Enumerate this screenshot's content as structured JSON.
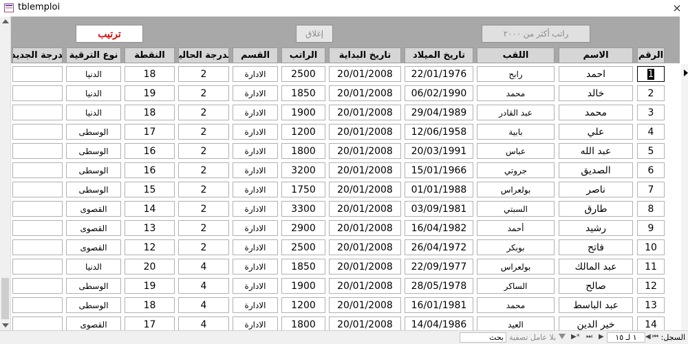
{
  "window": {
    "title": "tblemploi",
    "close_glyph": "×"
  },
  "buttons": {
    "sort": "ترتيب",
    "close": "إغلاق",
    "salary_filter": "راتب أكثر من ٢٠٠٠"
  },
  "columns": [
    {
      "key": "num",
      "label": "الرقم"
    },
    {
      "key": "name",
      "label": "الاسم"
    },
    {
      "key": "surname",
      "label": "اللقب"
    },
    {
      "key": "birth",
      "label": "تاريخ الميلاد"
    },
    {
      "key": "start",
      "label": "تاريخ البداية"
    },
    {
      "key": "salary",
      "label": "الراتب"
    },
    {
      "key": "dept",
      "label": "القسم"
    },
    {
      "key": "cur_grade",
      "label": "الدرجة الحالية"
    },
    {
      "key": "points",
      "label": "النقطة"
    },
    {
      "key": "promo",
      "label": "نوع الترقية"
    },
    {
      "key": "new_grade",
      "label": "الدرجة الجديدة"
    }
  ],
  "rows": [
    {
      "num": "1",
      "name": "احمد",
      "surname": "رابح",
      "birth": "22/01/1976",
      "start": "20/01/2008",
      "salary": "2500",
      "dept": "الادارة",
      "cur_grade": "2",
      "points": "18",
      "promo": "الدنيا",
      "new_grade": ""
    },
    {
      "num": "2",
      "name": "خالد",
      "surname": "محمد",
      "birth": "06/02/1990",
      "start": "20/01/2008",
      "salary": "1850",
      "dept": "الادارة",
      "cur_grade": "2",
      "points": "19",
      "promo": "الدنيا",
      "new_grade": ""
    },
    {
      "num": "3",
      "name": "محمد",
      "surname": "عبد القادر",
      "birth": "29/04/1989",
      "start": "20/01/2008",
      "salary": "1900",
      "dept": "الادارة",
      "cur_grade": "2",
      "points": "18",
      "promo": "الدنيا",
      "new_grade": ""
    },
    {
      "num": "4",
      "name": "علي",
      "surname": "بابية",
      "birth": "12/06/1958",
      "start": "20/01/2008",
      "salary": "1200",
      "dept": "الادارة",
      "cur_grade": "2",
      "points": "17",
      "promo": "الوسطى",
      "new_grade": ""
    },
    {
      "num": "5",
      "name": "عبد الله",
      "surname": "عباس",
      "birth": "20/03/1991",
      "start": "20/01/2008",
      "salary": "1800",
      "dept": "الادارة",
      "cur_grade": "2",
      "points": "16",
      "promo": "الوسطى",
      "new_grade": ""
    },
    {
      "num": "6",
      "name": "الصديق",
      "surname": "جروتي",
      "birth": "15/01/1966",
      "start": "20/01/2008",
      "salary": "3200",
      "dept": "الادارة",
      "cur_grade": "2",
      "points": "16",
      "promo": "الوسطى",
      "new_grade": ""
    },
    {
      "num": "7",
      "name": "ناصر",
      "surname": "بولعراس",
      "birth": "01/01/1988",
      "start": "20/01/2008",
      "salary": "1750",
      "dept": "الادارة",
      "cur_grade": "2",
      "points": "15",
      "promo": "الوسطى",
      "new_grade": ""
    },
    {
      "num": "8",
      "name": "طارق",
      "surname": "السبتي",
      "birth": "03/09/1981",
      "start": "20/01/2008",
      "salary": "3300",
      "dept": "الادارة",
      "cur_grade": "2",
      "points": "14",
      "promo": "القصوى",
      "new_grade": ""
    },
    {
      "num": "9",
      "name": "رشيد",
      "surname": "أحمد",
      "birth": "16/04/1982",
      "start": "20/01/2008",
      "salary": "2900",
      "dept": "الادارة",
      "cur_grade": "2",
      "points": "13",
      "promo": "القصوى",
      "new_grade": ""
    },
    {
      "num": "10",
      "name": "فاتح",
      "surname": "بوبكر",
      "birth": "26/04/1972",
      "start": "20/01/2008",
      "salary": "2500",
      "dept": "الادارة",
      "cur_grade": "2",
      "points": "12",
      "promo": "القصوى",
      "new_grade": ""
    },
    {
      "num": "11",
      "name": "عبد المالك",
      "surname": "بولعراس",
      "birth": "22/09/1977",
      "start": "20/01/2008",
      "salary": "1850",
      "dept": "الادارة",
      "cur_grade": "4",
      "points": "20",
      "promo": "الدنيا",
      "new_grade": ""
    },
    {
      "num": "12",
      "name": "صالح",
      "surname": "الساكر",
      "birth": "28/05/1978",
      "start": "20/01/2008",
      "salary": "1900",
      "dept": "الادارة",
      "cur_grade": "4",
      "points": "19",
      "promo": "الوسطى",
      "new_grade": ""
    },
    {
      "num": "13",
      "name": "عبد الباسط",
      "surname": "محمد",
      "birth": "16/01/1981",
      "start": "20/01/2008",
      "salary": "1200",
      "dept": "الادارة",
      "cur_grade": "4",
      "points": "18",
      "promo": "الوسطى",
      "new_grade": ""
    },
    {
      "num": "14",
      "name": "خير الدين",
      "surname": "العيد",
      "birth": "14/04/1986",
      "start": "20/01/2008",
      "salary": "1800",
      "dept": "الادارة",
      "cur_grade": "4",
      "points": "17",
      "promo": "القصوى",
      "new_grade": ""
    }
  ],
  "navigation": {
    "record_label": "السجل:",
    "first": "⏮",
    "prev": "◀",
    "counter": "١ لـ ١٥",
    "next": "▶",
    "last": "⏭",
    "new": "▶*",
    "filter_status": "بلا عامل تصفية",
    "search_placeholder": "بحث"
  },
  "icons": {
    "window_icon": "table-icon",
    "scroll_up": "triangle-up-icon",
    "scroll_down": "triangle-down-icon",
    "record_selector": "triangle-right-icon",
    "filter": "funnel-icon"
  }
}
